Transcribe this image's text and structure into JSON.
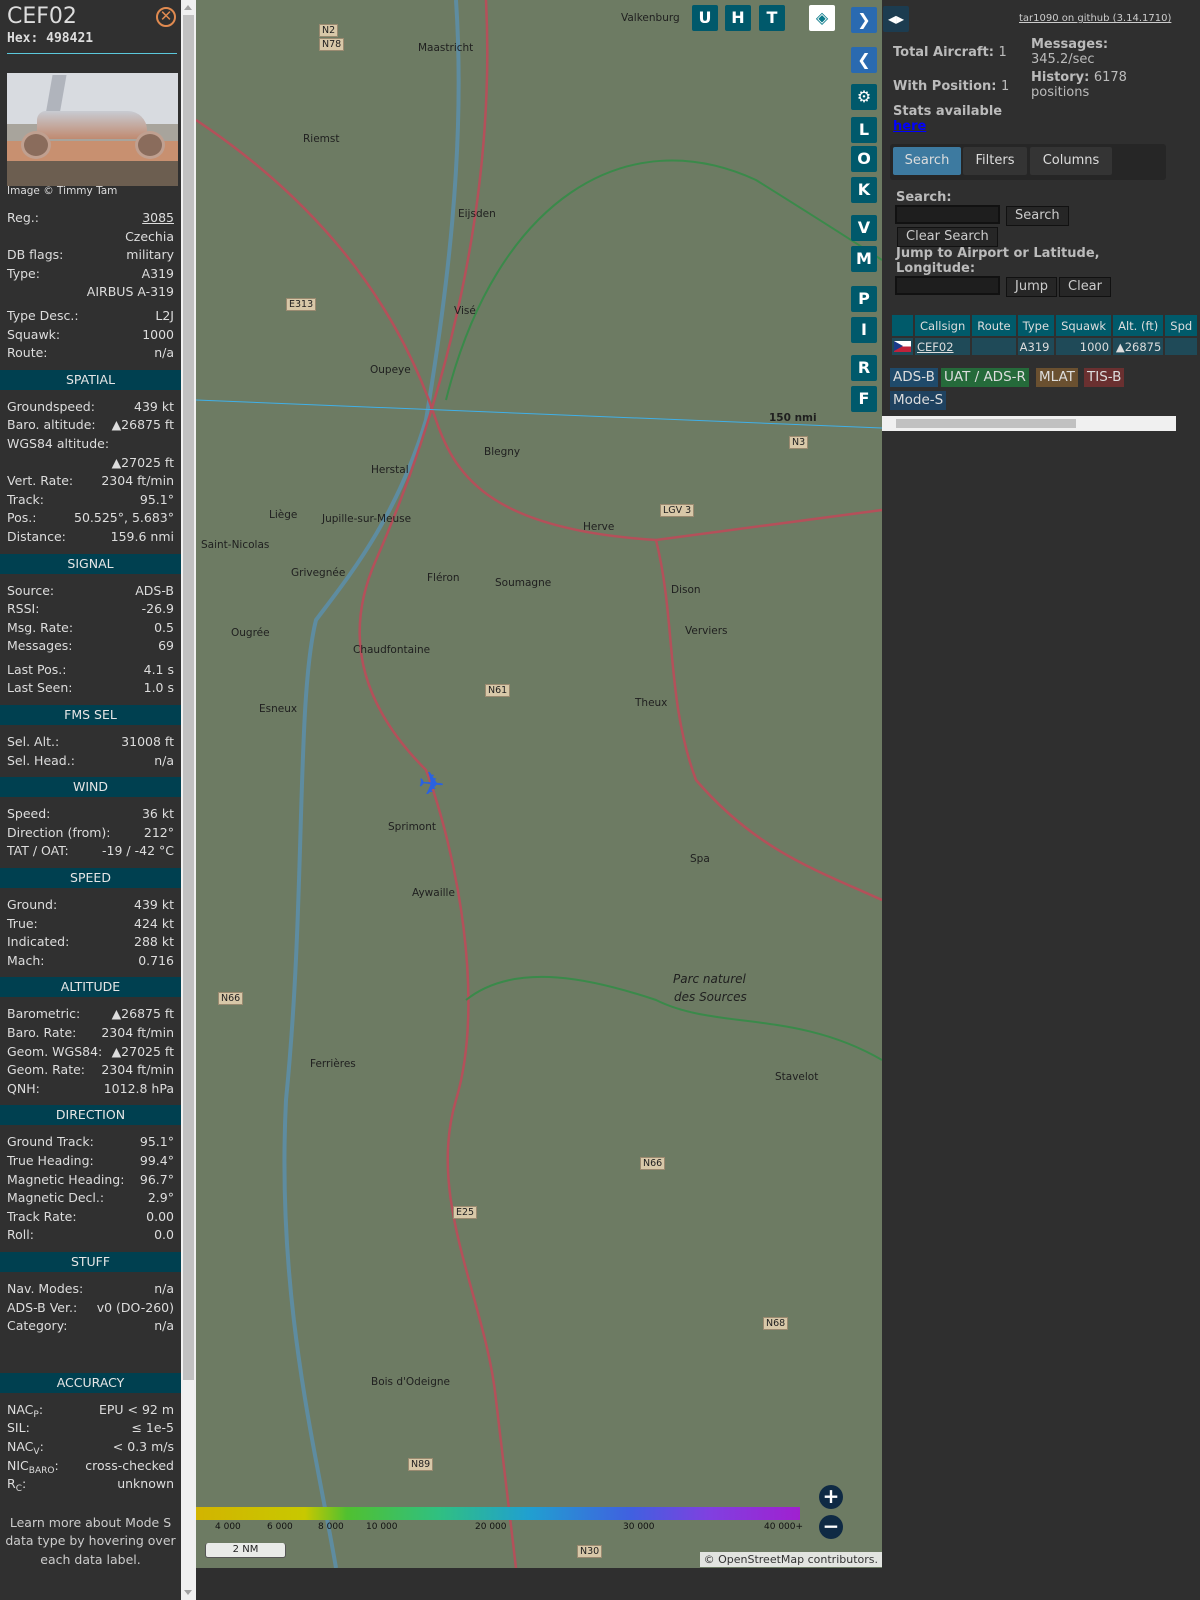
{
  "aircraft": {
    "callsign": "CEF02",
    "hex": "Hex: 498421",
    "image_caption": "Image © Timmy Tam",
    "close_icon": "close-icon"
  },
  "sections": [
    {
      "title": "",
      "rows": [
        [
          "Reg.:",
          "3085",
          "link"
        ],
        [
          "",
          "Czechia"
        ],
        [
          "DB flags:",
          "military"
        ],
        [
          "Type:",
          "A319"
        ],
        [
          "",
          "AIRBUS A-319"
        ],
        [
          "gap"
        ],
        [
          "Type Desc.:",
          "L2J"
        ],
        [
          "Squawk:",
          "1000"
        ],
        [
          "Route:",
          "n/a"
        ]
      ]
    },
    {
      "title": "SPATIAL",
      "rows": [
        [
          "Groundspeed:",
          "439 kt"
        ],
        [
          "Baro. altitude:",
          "▲26875 ft"
        ],
        [
          "WGS84 altitude:",
          ""
        ],
        [
          "",
          "▲27025 ft"
        ],
        [
          "Vert. Rate:",
          "2304 ft/min"
        ],
        [
          "Track:",
          "95.1°"
        ],
        [
          "Pos.:",
          "50.525°, 5.683°"
        ],
        [
          "Distance:",
          "159.6 nmi"
        ]
      ]
    },
    {
      "title": "SIGNAL",
      "rows": [
        [
          "Source:",
          "ADS-B"
        ],
        [
          "RSSI:",
          "-26.9"
        ],
        [
          "Msg. Rate:",
          "0.5"
        ],
        [
          "Messages:",
          "69"
        ],
        [
          "gap"
        ],
        [
          "Last Pos.:",
          "4.1 s"
        ],
        [
          "Last Seen:",
          "1.0 s"
        ]
      ]
    },
    {
      "title": "FMS SEL",
      "rows": [
        [
          "Sel. Alt.:",
          "31008 ft"
        ],
        [
          "Sel. Head.:",
          "n/a"
        ]
      ]
    },
    {
      "title": "WIND",
      "rows": [
        [
          "Speed:",
          "36 kt"
        ],
        [
          "Direction (from):",
          "212°"
        ],
        [
          "TAT / OAT:",
          "-19 / -42 °C"
        ]
      ]
    },
    {
      "title": "SPEED",
      "rows": [
        [
          "Ground:",
          "439 kt"
        ],
        [
          "True:",
          "424 kt"
        ],
        [
          "Indicated:",
          "288 kt"
        ],
        [
          "Mach:",
          "0.716"
        ]
      ]
    },
    {
      "title": "ALTITUDE",
      "rows": [
        [
          "Barometric:",
          "▲26875 ft"
        ],
        [
          "Baro. Rate:",
          "2304 ft/min"
        ],
        [
          "Geom. WGS84:",
          "▲27025 ft"
        ],
        [
          "Geom. Rate:",
          "2304 ft/min"
        ],
        [
          "QNH:",
          "1012.8 hPa"
        ]
      ]
    },
    {
      "title": "DIRECTION",
      "rows": [
        [
          "Ground Track:",
          "95.1°"
        ],
        [
          "True Heading:",
          "99.4°"
        ],
        [
          "Magnetic Heading:",
          "96.7°"
        ],
        [
          "Magnetic Decl.:",
          "2.9°"
        ],
        [
          "Track Rate:",
          "0.00"
        ],
        [
          "Roll:",
          "0.0"
        ]
      ]
    },
    {
      "title": "STUFF",
      "rows": [
        [
          "Nav. Modes:",
          "n/a"
        ],
        [
          "ADS-B Ver.:",
          "v0 (DO-260)"
        ],
        [
          "Category:",
          "n/a"
        ],
        [
          "gapXL"
        ]
      ]
    },
    {
      "title": "ACCURACY",
      "rows": [
        [
          "NAC|P:",
          "EPU < 92 m"
        ],
        [
          "SIL:",
          "≤ 1e-5"
        ],
        [
          "NAC|V:",
          "< 0.3 m/s"
        ],
        [
          "NIC|BARO:",
          "cross-checked"
        ],
        [
          "R|C:",
          "unknown"
        ]
      ]
    }
  ],
  "footer": "Learn more about Mode S data type by hovering over each data label.",
  "map": {
    "towns": [
      "Maastricht",
      "Valkenburg",
      "Riemst",
      "Eijsden",
      "Visé",
      "Oupeye",
      "Herstal",
      "Blegny",
      "Liège",
      "Jupille-sur-Meuse",
      "Herve",
      "Saint-Nicolas",
      "Grivegnée",
      "Fléron",
      "Soumagne",
      "Dison",
      "Verviers",
      "Ougrée",
      "Chaudfontaine",
      "Esneux",
      "Theux",
      "Sprimont",
      "Spa",
      "Aywaille",
      "Parc naturel",
      "des Sources",
      "Ferrières",
      "Stavelot",
      "Bois d'Odeigne",
      "N2",
      "N78",
      "E313",
      "N3",
      "N61",
      "N66",
      "N66",
      "E25",
      "N68",
      "N89",
      "N30",
      "LGV 3"
    ],
    "range_label": "150 nmi",
    "top_buttons": [
      "U",
      "H",
      "T"
    ],
    "side_buttons": [
      "L",
      "O",
      "K",
      "V",
      "M",
      "P",
      "I",
      "R",
      "F"
    ],
    "legend": [
      "4 000",
      "6 000",
      "8 000",
      "10 000",
      "20 000",
      "30 000",
      "40 000+"
    ],
    "scale": "2 NM",
    "attribution": "© OpenStreetMap contributors.",
    "zoom_in": "+",
    "zoom_out": "−"
  },
  "panel": {
    "github": "tar1090 on github (3.14.1710)",
    "total_label": "Total Aircraft:",
    "total": "1",
    "withpos_label": "With Position:",
    "withpos": "1",
    "messages_label": "Messages:",
    "messages": "345.2/sec",
    "history_label": "History:",
    "history": "6178 positions",
    "stats_label": "Stats available",
    "stats_link": "here",
    "tabs": [
      "Search",
      "Filters",
      "Columns"
    ],
    "search_label": "Search:",
    "search_value": "",
    "search_btn": "Search",
    "clear_search_btn": "Clear Search",
    "jump_label": "Jump to Airport or Latitude, Longitude:",
    "jump_value": "",
    "jump_btn": "Jump",
    "clear_btn": "Clear",
    "columns": [
      "",
      "Callsign",
      "Route",
      "Type",
      "Squawk",
      "Alt. (ft)",
      "Spd"
    ],
    "rows": [
      {
        "flag": "Czechia",
        "callsign": "CEF02",
        "route": "",
        "type": "A319",
        "squawk": "1000",
        "alt": "▲26875",
        "spd": ""
      }
    ],
    "badges": [
      {
        "label": "ADS-B",
        "color": "#1f4a6a"
      },
      {
        "label": "UAT / ADS-R",
        "color": "#256a3a"
      },
      {
        "label": "MLAT",
        "color": "#6a5030"
      },
      {
        "label": "TIS-B",
        "color": "#6a3030"
      },
      {
        "label": "Mode-S",
        "color": "#1f4260"
      }
    ]
  }
}
